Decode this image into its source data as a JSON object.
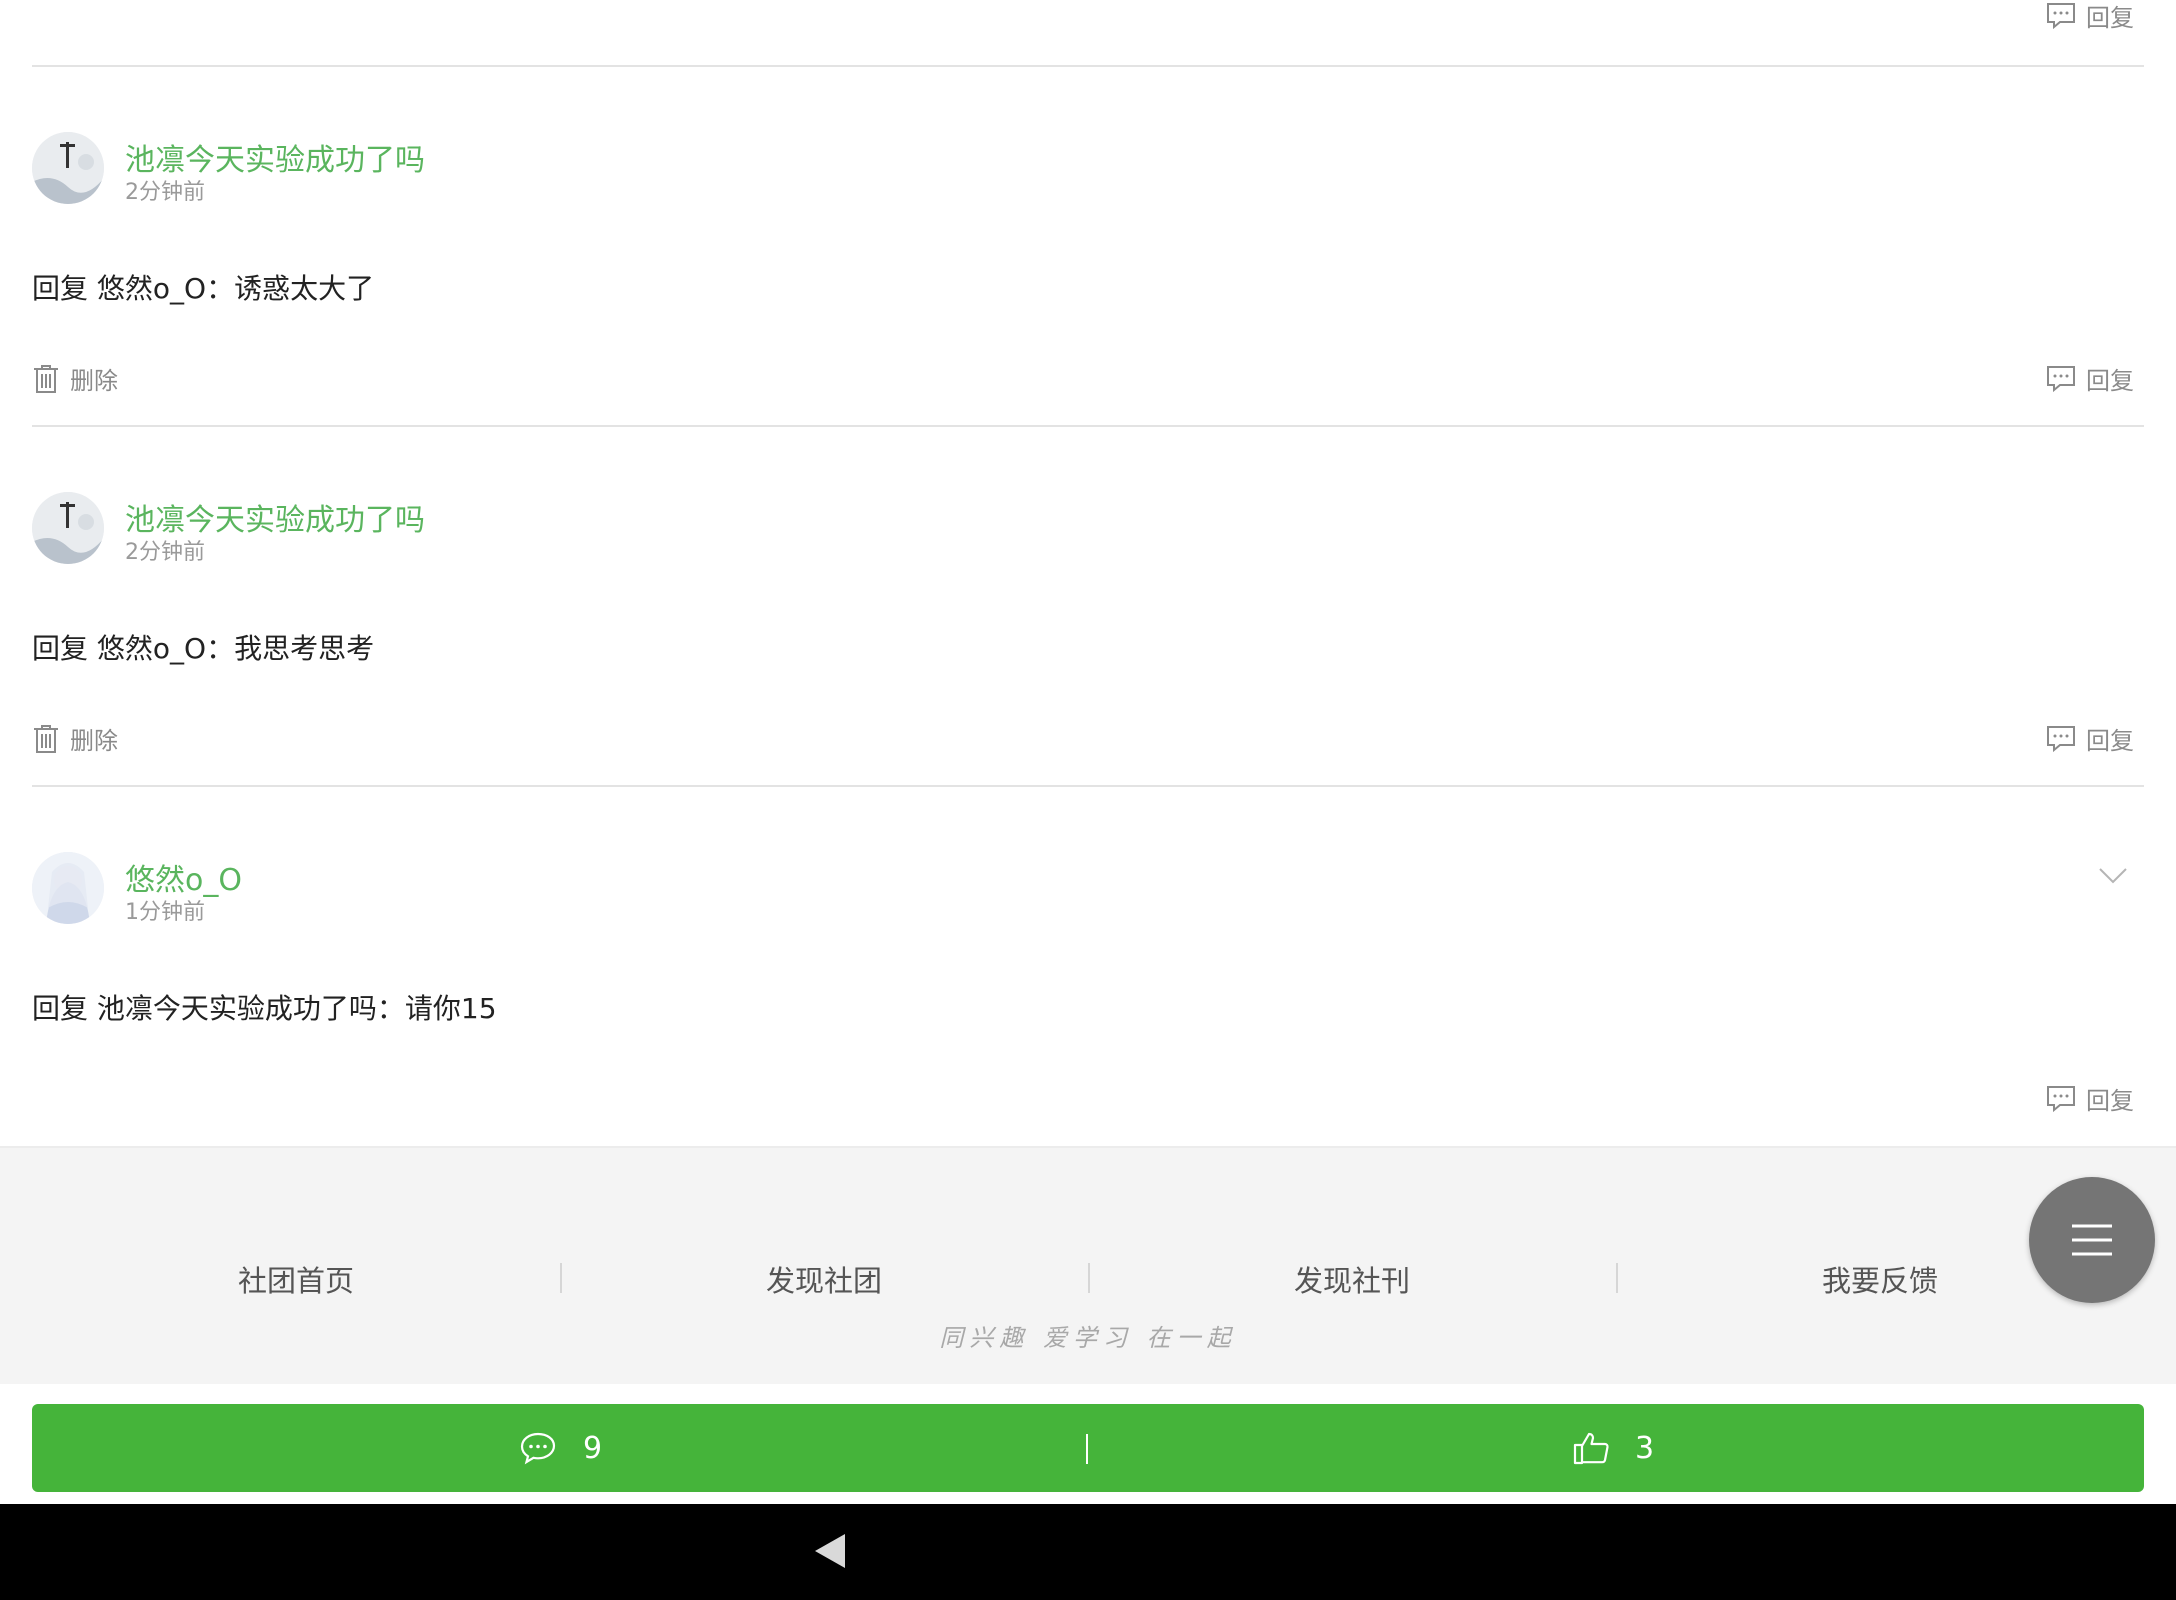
{
  "actions": {
    "reply_label": "回复",
    "delete_label": "删除"
  },
  "comments": [
    {
      "author": "池凛今天实验成功了吗",
      "time": "2分钟前",
      "content": "回复 悠然o_O：诱惑太大了"
    },
    {
      "author": "池凛今天实验成功了吗",
      "time": "2分钟前",
      "content": "回复 悠然o_O：我思考思考"
    },
    {
      "author": "悠然o_O",
      "time": "1分钟前",
      "content": "回复 池凛今天实验成功了吗：请你15"
    }
  ],
  "footer": {
    "nav": [
      "社团首页",
      "发现社团",
      "发现社刊",
      "我要反馈"
    ],
    "slogan": "同兴趣 爱学习 在一起"
  },
  "bottom_bar": {
    "comment_count": "9",
    "like_count": "3"
  },
  "colors": {
    "accent_green": "#45b43a",
    "author_green": "#5ab55e"
  },
  "icons": [
    "reply-icon",
    "trash-icon",
    "chevron-down-icon",
    "menu-icon",
    "comment-icon",
    "thumbs-up-icon",
    "back-icon"
  ]
}
